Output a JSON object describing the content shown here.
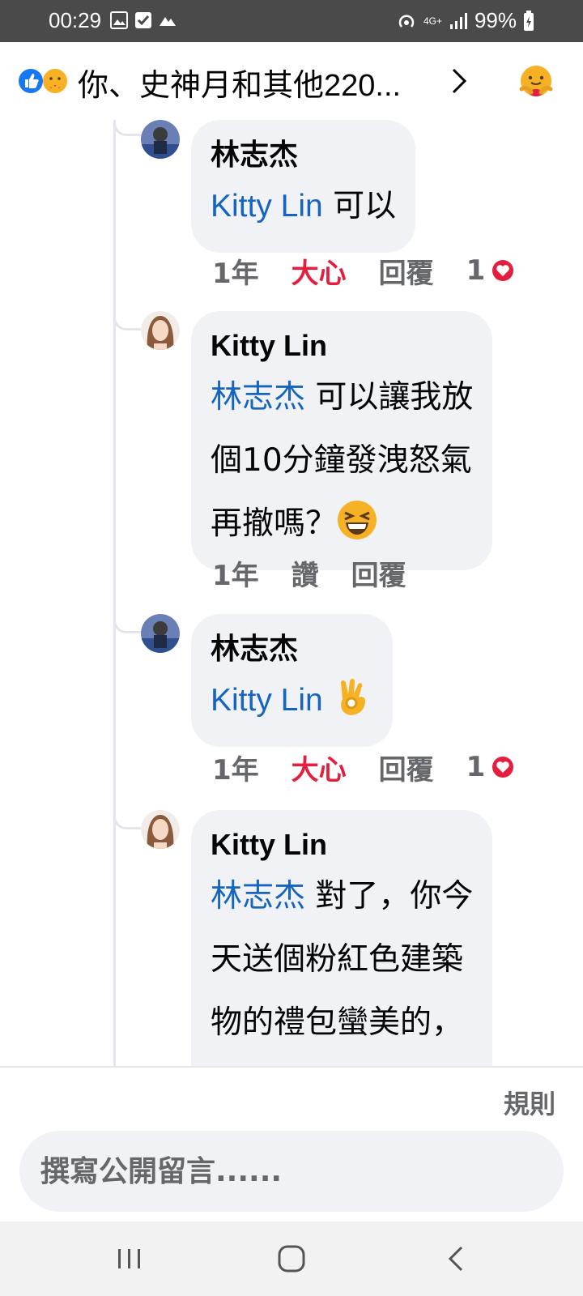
{
  "status_bar": {
    "time": "00:29",
    "network": "4G+",
    "battery": "99%"
  },
  "header": {
    "reactions_summary": "你、史神月和其他220..."
  },
  "comments": [
    {
      "author": "林志杰",
      "mention": "Kitty Lin",
      "text": " 可以",
      "time": "1年",
      "reaction": "大心",
      "reply": "回覆",
      "count": "1"
    },
    {
      "author": "Kitty Lin",
      "mention": "林志杰",
      "lines": [
        " 可以讓我放",
        "個10分鐘發洩怒氣",
        "再撤嗎？"
      ],
      "emoji": "laughing-emoji",
      "time": "1年",
      "reaction": "讚",
      "reply": "回覆"
    },
    {
      "author": "林志杰",
      "mention": "Kitty Lin",
      "text": " ",
      "emoji": "ok-hand-emoji",
      "time": "1年",
      "reaction": "大心",
      "reply": "回覆",
      "count": "1"
    },
    {
      "author": "Kitty Lin",
      "mention": "林志杰",
      "lines": [
        " 對了，你今",
        "天送個粉紅色建築",
        "物的禮包蠻美的，"
      ]
    }
  ],
  "footer": {
    "rules_label": "規則",
    "composer_placeholder": "撰寫公開留言......"
  },
  "colors": {
    "mention": "#1565c0",
    "love": "#e41e3f",
    "bubble": "#f0f2f5",
    "meta": "#65676b"
  }
}
